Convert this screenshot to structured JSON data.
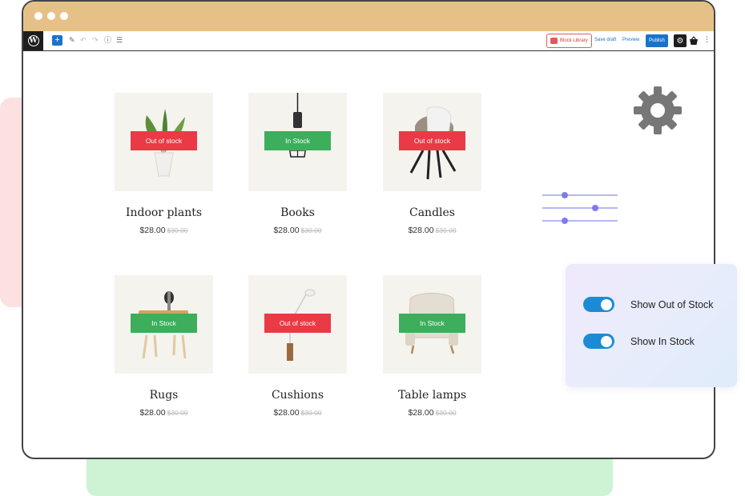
{
  "colors": {
    "titlebar": "#e6c187",
    "out_of_stock": "#ea3a45",
    "in_stock": "#3cae5c",
    "accent": "#1a73c9",
    "toggle": "#1c8bd6"
  },
  "toolbar": {
    "wp_logo": "W",
    "block_library": "Block Library",
    "save_draft": "Save draft",
    "preview": "Preview",
    "publish": "Publish",
    "icons": [
      "plus-icon",
      "pencil-icon",
      "undo-icon",
      "redo-icon",
      "info-icon",
      "list-view-icon",
      "gear-icon",
      "basket-icon",
      "more-icon"
    ]
  },
  "products": [
    {
      "name": "Indoor plants",
      "price": "$28.00",
      "old_price": "$30.00",
      "badge": "Out of stock",
      "status": "out"
    },
    {
      "name": "Books",
      "price": "$28.00",
      "old_price": "$30.00",
      "badge": "In Stock",
      "status": "in"
    },
    {
      "name": "Candles",
      "price": "$28.00",
      "old_price": "$30.00",
      "badge": "Out of stock",
      "status": "out"
    },
    {
      "name": "Rugs",
      "price": "$28.00",
      "old_price": "$30.00",
      "badge": "In Stock",
      "status": "in"
    },
    {
      "name": "Cushions",
      "price": "$28.00",
      "old_price": "$30.00",
      "badge": "Out of stock",
      "status": "out"
    },
    {
      "name": "Table lamps",
      "price": "$28.00",
      "old_price": "$30.00",
      "badge": "In Stock",
      "status": "in"
    }
  ],
  "settings": {
    "toggles": [
      {
        "label": "Show Out of Stock",
        "on": true
      },
      {
        "label": "Show In Stock",
        "on": true
      }
    ]
  }
}
